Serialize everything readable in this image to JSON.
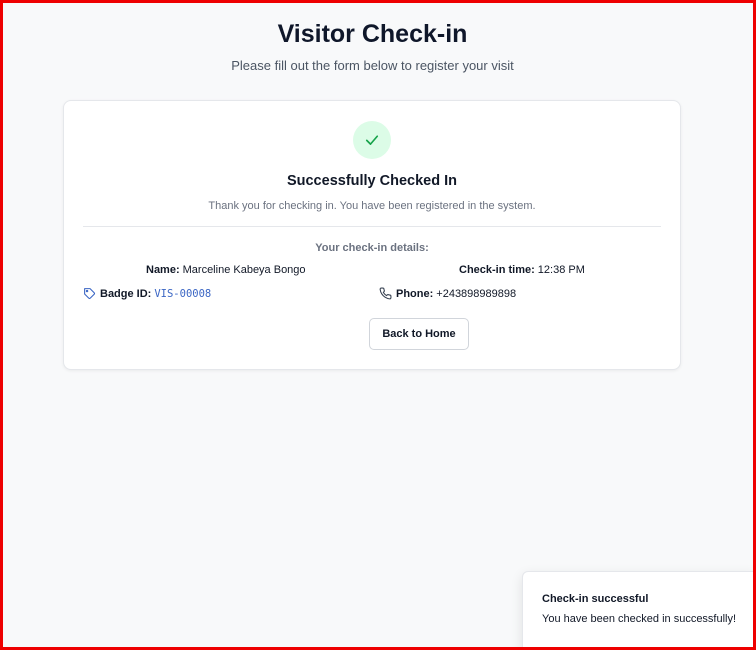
{
  "header": {
    "title": "Visitor Check-in",
    "subtitle": "Please fill out the form below to register your visit"
  },
  "card": {
    "status_icon": "check-icon",
    "title": "Successfully Checked In",
    "message": "Thank you for checking in. You have been registered in the system.",
    "details_heading": "Your check-in details:",
    "details": {
      "name_label": "Name:",
      "name_value": "Marceline Kabeya Bongo",
      "time_label": "Check-in time:",
      "time_value": "12:38 PM",
      "badge_label": "Badge ID:",
      "badge_value": "VIS-00008",
      "badge_icon": "tag-icon",
      "phone_label": "Phone:",
      "phone_value": "+243898989898",
      "phone_icon": "phone-icon"
    },
    "back_button": "Back to Home"
  },
  "toast": {
    "title": "Check-in successful",
    "message": "You have been checked in successfully!"
  },
  "colors": {
    "success_bg": "#dcfce7",
    "success_check": "#16a34a",
    "badge_text": "#3b66c4",
    "frame": "#ee0000"
  }
}
